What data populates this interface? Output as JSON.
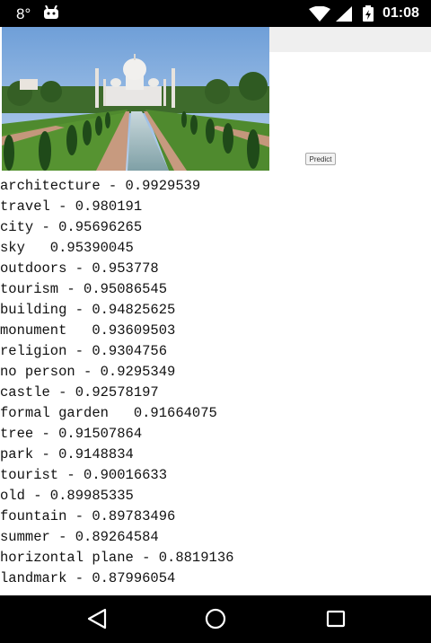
{
  "status_bar": {
    "temperature": "8°",
    "time": "01:08",
    "icons": [
      "android-notification-icon",
      "wifi-icon",
      "signal-icon",
      "battery-icon"
    ]
  },
  "image": {
    "subject": "taj-mahal-photo"
  },
  "predict_button": {
    "label": "Predict"
  },
  "predictions": [
    "architecture - 0.9929539",
    "travel - 0.980191",
    "city - 0.95696265",
    "sky   0.95390045",
    "outdoors - 0.953778",
    "tourism - 0.95086545",
    "building - 0.94825625",
    "monument   0.93609503",
    "religion - 0.9304756",
    "no person - 0.9295349",
    "castle - 0.92578197",
    "formal garden   0.91664075",
    "tree - 0.91507864",
    "park - 0.9148834",
    "tourist - 0.90016633",
    "old - 0.89985335",
    "fountain - 0.89783496",
    "summer - 0.89264584",
    "horizontal plane - 0.8819136",
    "landmark - 0.87996054"
  ],
  "nav_bar": {
    "buttons": [
      "back-icon",
      "home-icon",
      "recents-icon"
    ]
  }
}
